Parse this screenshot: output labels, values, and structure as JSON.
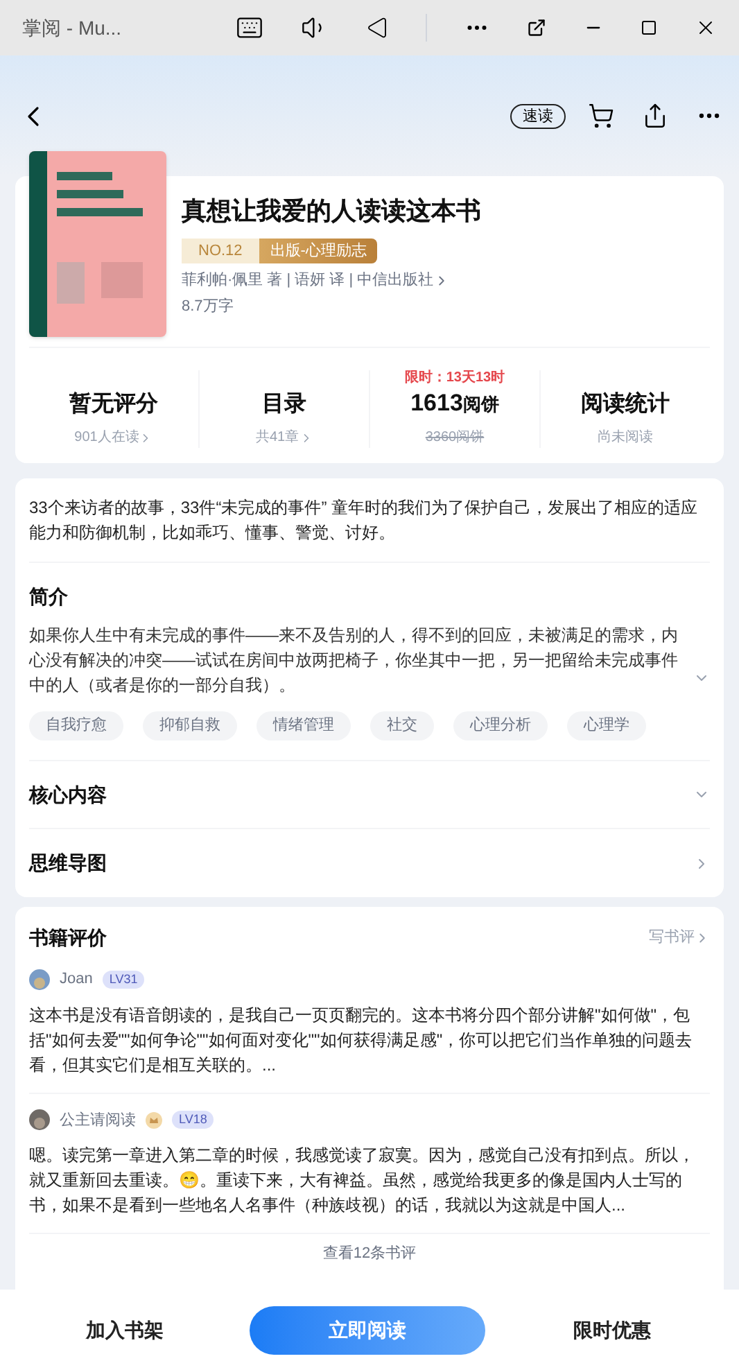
{
  "window": {
    "title": "掌阅 - Mu..."
  },
  "nav": {
    "quick_read": "速读"
  },
  "book": {
    "title": "真想让我爱的人读读这本书",
    "rank": "NO.12",
    "category": "出版-心理励志",
    "credits": "菲利帕·佩里 著 | 语妍 译 | 中信出版社",
    "words": "8.7万字"
  },
  "stats": [
    {
      "kind": "link",
      "value": "暂无评分",
      "sub": "901人在读"
    },
    {
      "kind": "link",
      "value": "目录",
      "sub": "共41章"
    },
    {
      "kind": "price",
      "promo": "限时：13天13时",
      "value": "1613",
      "unit": "阅饼",
      "sub": "3360阅饼"
    },
    {
      "kind": "plain",
      "value": "阅读统计",
      "sub": "尚未阅读"
    }
  ],
  "summary": "33个来访者的故事，33件“未完成的事件” 童年时的我们为了保护自己，发展出了相应的适应能力和防御机制，比如乖巧、懂事、警觉、讨好。",
  "intro": {
    "title": "简介",
    "text": "如果你人生中有未完成的事件——来不及告别的人，得不到的回应，未被满足的需求，内心没有解决的冲突——试试在房间中放两把椅子，你坐其中一把，另一把留给未完成事件中的人（或者是你的一部分自我）。",
    "expanded": false
  },
  "tags": [
    "自我疗愈",
    "抑郁自救",
    "情绪管理",
    "社交",
    "心理分析",
    "心理学"
  ],
  "sections": [
    {
      "title": "核心内容",
      "kind": "expand"
    },
    {
      "title": "思维导图",
      "kind": "link"
    }
  ],
  "reviews": {
    "title": "书籍评价",
    "write": "写书评",
    "more": "查看12条书评",
    "items": [
      {
        "user": "Joan",
        "crown": false,
        "level": "LV31",
        "text": "这本书是没有语音朗读的，是我自己一页页翻完的。这本书将分四个部分讲解\"如何做\"，包括\"如何去爱\"\"如何争论\"\"如何面对变化\"\"如何获得满足感\"，你可以把它们当作单独的问题去看，但其实它们是相互关联的。..."
      },
      {
        "user": "公主请阅读",
        "crown": true,
        "level": "LV18",
        "text": "嗯。读完第一章进入第二章的时候，我感觉读了寂寞。因为，感觉自己没有扣到点。所以，就又重新回去重读。😁。重读下来，大有裨益。虽然，感觉给我更多的像是国内人士写的书，如果不是看到一些地名人名事件（种族歧视）的话，我就以为这就是中国人..."
      }
    ]
  },
  "bottom": {
    "shelf": "加入书架",
    "read": "立即阅读",
    "offer": "限时优惠"
  }
}
